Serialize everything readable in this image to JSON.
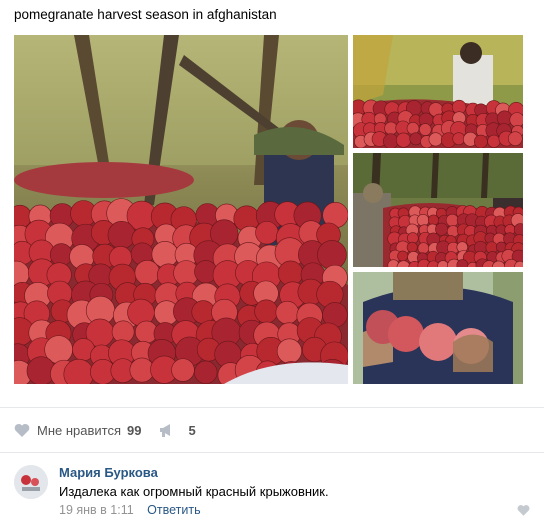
{
  "post": {
    "text": "pomegranate harvest season in afghanistan"
  },
  "photos": [
    {
      "name": "photo-main",
      "alt": "pomegranate pile with harvester"
    },
    {
      "name": "photo-top-right",
      "alt": "man picking pomegranates"
    },
    {
      "name": "photo-mid-right",
      "alt": "workers sorting pomegranates"
    },
    {
      "name": "photo-bot-right",
      "alt": "hands holding pomegranates"
    }
  ],
  "actions": {
    "like_label": "Мне нравится",
    "like_count": "99",
    "share_count": "5",
    "like_icon": "heart-icon",
    "share_icon": "megaphone-icon"
  },
  "comment": {
    "author": "Мария Буркова",
    "text": "Издалека как огромный красный крыжовник.",
    "date": "19 янв в 1:11",
    "reply_label": "Ответить"
  },
  "colors": {
    "link": "#2a5885",
    "muted": "#939393",
    "pomegranate": "#c8323a"
  }
}
